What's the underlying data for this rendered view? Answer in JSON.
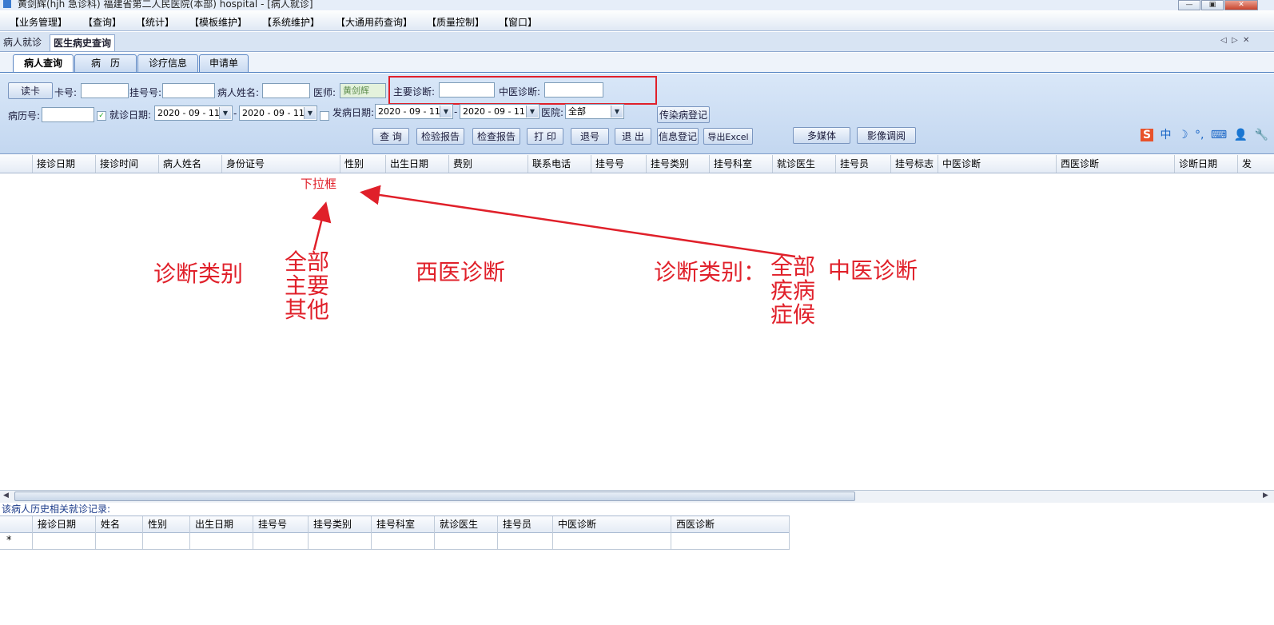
{
  "window": {
    "title": "黄剑辉(hjh 急诊科) 福建省第二人民医院(本部) hospital - [病人就诊]",
    "controls": [
      "—",
      "▣",
      "✕"
    ]
  },
  "menu": [
    "【业务管理】",
    "【查询】",
    "【统计】",
    "【模板维护】",
    "【系统维护】",
    "【大通用药查询】",
    "【质量控制】",
    "【窗口】"
  ],
  "doc_tabs": [
    "病人就诊",
    "医生病史查询"
  ],
  "doc_nav": [
    "◁",
    "▷",
    "✕"
  ],
  "sub_tabs": [
    "病人查询",
    "病　历",
    "诊疗信息",
    "申请单"
  ],
  "form": {
    "read_card": "读卡",
    "card_no_label": "卡号:",
    "card_no_value": "",
    "reg_no_label": "挂号号:",
    "reg_no_value": "",
    "patient_name_label": "病人姓名:",
    "patient_name_value": "",
    "doctor_label": "医师:",
    "doctor_value": "黄剑辉",
    "main_diag_label": "主要诊断:",
    "main_diag_value": "",
    "tcm_diag_label": "中医诊断:",
    "tcm_diag_value": "",
    "record_no_label": "病历号:",
    "record_no_value": "",
    "visit_date_label": "就诊日期:",
    "visit_date_from": "2020 - 09 - 11",
    "visit_date_to": "2020 - 09 - 11",
    "onset_date_label": "发病日期:",
    "onset_date_from": "2020 - 09 - 11",
    "onset_date_to": "2020 - 09 - 11",
    "hospital_label": "医院:",
    "hospital_value": "全部",
    "date_sep": "-",
    "check_mark": "✓"
  },
  "buttons": {
    "infectious": "传染病登记",
    "query": "查 询",
    "lab_report": "检验报告",
    "exam_report": "检查报告",
    "print": "打 印",
    "cancel_reg": "退号",
    "exit": "退 出",
    "info_reg": "信息登记",
    "export": "导出Excel",
    "multimedia": "多媒体",
    "image_view": "影像调阅"
  },
  "ime_icons": [
    "S",
    "中",
    "☽",
    "°,",
    "⌨",
    "👤",
    "🔧"
  ],
  "main_grid": {
    "columns": [
      "接诊日期",
      "接诊时间",
      "病人姓名",
      "身份证号",
      "性别",
      "出生日期",
      "费别",
      "联系电话",
      "挂号号",
      "挂号类别",
      "挂号科室",
      "就诊医生",
      "挂号员",
      "挂号标志",
      "中医诊断",
      "西医诊断",
      "诊断日期",
      "发"
    ]
  },
  "annotations": {
    "dropdown": "下拉框",
    "diag_type": "诊断类别",
    "options_left": [
      "全部",
      "主要",
      "其他"
    ],
    "western": "西医诊断",
    "diag_type_colon": "诊断类别：",
    "options_right": [
      "全部",
      "疾病",
      "症候"
    ],
    "tcm": "中医诊断"
  },
  "history": {
    "label": "该病人历史相关就诊记录:",
    "columns": [
      "接诊日期",
      "姓名",
      "性别",
      "出生日期",
      "挂号号",
      "挂号类别",
      "挂号科室",
      "就诊医生",
      "挂号员",
      "中医诊断",
      "西医诊断"
    ],
    "new_row_marker": "*"
  },
  "scroll_arrows": [
    "◀",
    "▶"
  ]
}
